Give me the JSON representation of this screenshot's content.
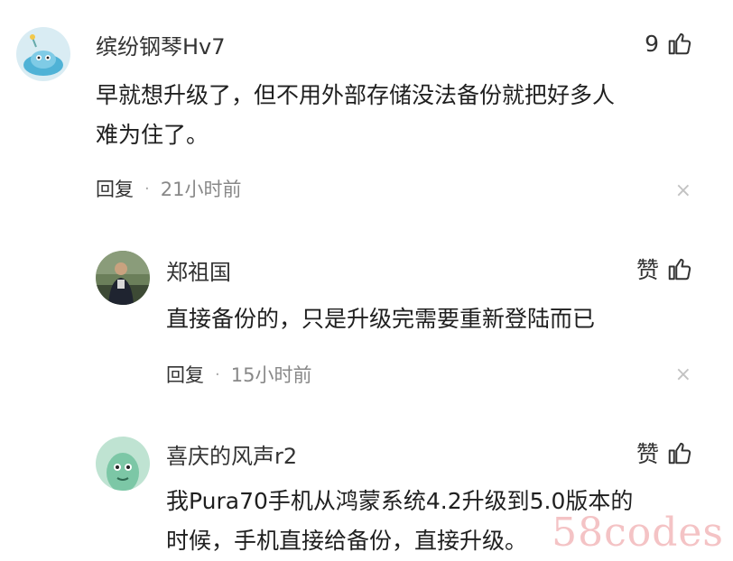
{
  "comments": [
    {
      "username": "缤纷钢琴Hv7",
      "like_count": "9",
      "content_lines": [
        "早就想升级了，但不用外部存储没法备份就把好多人",
        "难为住了。"
      ],
      "reply_label": "回复",
      "separator": "·",
      "time": "21小时前",
      "close_symbol": "×",
      "avatar_icon": "cartoon-bird-avatar"
    },
    {
      "username": "郑祖国",
      "like_label": "赞",
      "content_lines": [
        "直接备份的，只是升级完需要重新登陆而已"
      ],
      "reply_label": "回复",
      "separator": "·",
      "time": "15小时前",
      "close_symbol": "×",
      "avatar_icon": "person-photo-avatar"
    },
    {
      "username": "喜庆的风声r2",
      "like_label": "赞",
      "content_lines": [
        "我Pura70手机从鸿蒙系统4.2升级到5.0版本的",
        "时候，手机直接给备份，直接升级。"
      ],
      "avatar_icon": "cartoon-character-avatar"
    }
  ],
  "watermark": "58codes",
  "colors": {
    "text": "#1f1f1f",
    "meta": "#888888",
    "close": "#c2c2c2",
    "watermark": "#f3b9bb"
  }
}
